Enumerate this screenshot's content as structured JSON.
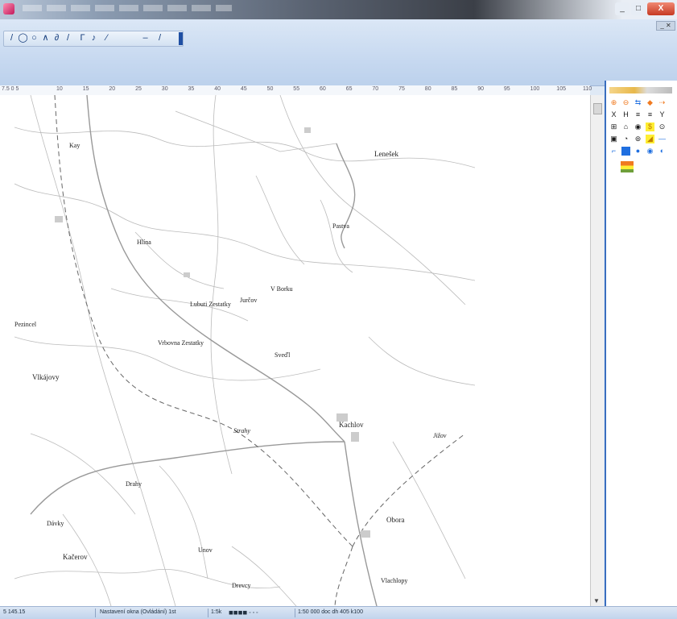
{
  "window": {
    "close_label": "X",
    "minimize_label": "_",
    "maximize_label": "□",
    "mdi_label": "_ ✕"
  },
  "toolbar": {
    "draw_tools": [
      "/",
      "◯",
      "○",
      "∧",
      "∂",
      "/",
      "Γ",
      "♪",
      "⁄",
      "–",
      "/"
    ]
  },
  "ruler": {
    "start_label": "7.5 0 5",
    "ticks": [
      "10",
      "15",
      "20",
      "25",
      "30",
      "35",
      "40",
      "45",
      "50",
      "55",
      "60",
      "65",
      "70",
      "75",
      "80",
      "85",
      "90",
      "95",
      "100",
      "105",
      "110"
    ]
  },
  "map": {
    "labels": [
      "Lenešek",
      "Kay",
      "Hlína",
      "Pastva",
      "Lubuti Zestatky",
      "Jurčov",
      "V Borku",
      "Pezincel",
      "Vrbovna Zestatky",
      "Sveďl",
      "Vlkájovy",
      "Strahy",
      "Kachlov",
      "Jižov",
      "Drahy",
      "Dávky",
      "Kačerov",
      "Unov",
      "Obora",
      "Drevcy",
      "Vlachlopy"
    ]
  },
  "palette": {
    "symbols": [
      "⊕",
      "⊖",
      "⇆",
      "◆",
      "⇢",
      "X",
      "H",
      "≡",
      "≡",
      "Y",
      "⊞",
      "⌂",
      "◉",
      "$",
      "⊙",
      "▣",
      "◔",
      "⊚",
      "◢",
      "—",
      "⌐",
      "■",
      "●",
      "◉",
      "◐"
    ],
    "colors": {
      "accent": "#3a6ebf",
      "yellow": "#ffee33",
      "blue": "#1f6fe0",
      "orange": "#f07a20"
    }
  },
  "status": {
    "coords": "5  145.15",
    "mode": "Nastavení okna (Ovládání) 1st",
    "scale": "1:5k",
    "zoom_info": "1:50 000 doc dh 405 k100"
  }
}
